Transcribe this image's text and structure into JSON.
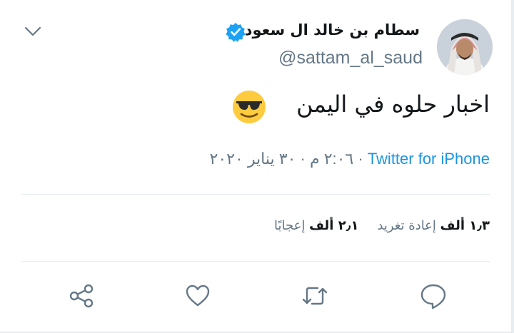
{
  "user": {
    "display_name": "سطام بن خالد ال سعود",
    "handle": "@sattam_al_saud",
    "verified": true
  },
  "tweet": {
    "text": "اخبار حلوه في اليمن",
    "emoji": "smiling-face-with-sunglasses",
    "timestamp": "٢:٠٦ م · ٣٠ يناير ٢٠٢٠ · ",
    "source": "Twitter for iPhone"
  },
  "stats": {
    "retweets_count": "١٫٣ ألف",
    "retweets_label": "إعادة تغريد",
    "likes_count": "٢٫١ ألف",
    "likes_label": "إعجابًا"
  },
  "actions": [
    "reply-icon",
    "retweet-icon",
    "like-icon",
    "share-icon"
  ],
  "colors": {
    "link": "#1b95e0",
    "muted": "#657786",
    "text": "#14171a",
    "divider": "#e6ecf0"
  }
}
